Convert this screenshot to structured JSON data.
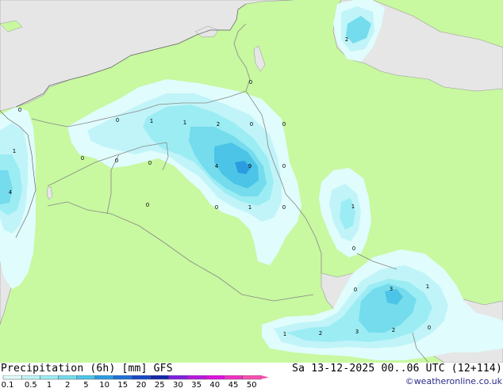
{
  "title": "Precipitation (6h) [mm] GFS",
  "datetime": "Sa 13-12-2025 00..06 UTC (12+114)",
  "credit": "©weatheronline.co.uk",
  "legend": {
    "labels": [
      "0.1",
      "0.5",
      "1",
      "2",
      "5",
      "10",
      "15",
      "20",
      "25",
      "30",
      "35",
      "40",
      "45",
      "50"
    ],
    "colors": [
      "#e0fcfc",
      "#c0f4f8",
      "#9cecf4",
      "#74dcec",
      "#4cc4e8",
      "#2c9ce0",
      "#2070d8",
      "#1848c8",
      "#1028a8",
      "#8020e0",
      "#b818e0",
      "#e010e0",
      "#f030c8",
      "#f850b0"
    ]
  },
  "map_labels": [
    {
      "text": "2",
      "region": "caspian"
    },
    {
      "text": "0",
      "region": "lebanon-coast"
    },
    {
      "text": "1",
      "region": "levant-north"
    },
    {
      "text": "4",
      "region": "levant-south"
    },
    {
      "text": "0",
      "region": "syria-west"
    },
    {
      "text": "0",
      "region": "syria-desert"
    },
    {
      "text": "0",
      "region": "syria-central"
    },
    {
      "text": "0",
      "region": "syria-east"
    },
    {
      "text": "1",
      "region": "north-iraq"
    },
    {
      "text": "1",
      "region": "north-iraq-east"
    },
    {
      "text": "2",
      "region": "kurdistan"
    },
    {
      "text": "0",
      "region": "zagros-north"
    },
    {
      "text": "0",
      "region": "iran-border"
    },
    {
      "text": "0",
      "region": "turkey-east"
    },
    {
      "text": "4",
      "region": "iraq-central-west"
    },
    {
      "text": "9",
      "region": "baghdad"
    },
    {
      "text": "0",
      "region": "iran-west"
    },
    {
      "text": "0",
      "region": "iraq-west"
    },
    {
      "text": "0",
      "region": "euphrates"
    },
    {
      "text": "1",
      "region": "iraq-south"
    },
    {
      "text": "0",
      "region": "basra"
    },
    {
      "text": "1",
      "region": "iran-southwest"
    },
    {
      "text": "0",
      "region": "gulf-north"
    },
    {
      "text": "0",
      "region": "gulf-coast-north"
    },
    {
      "text": "3",
      "region": "gulf-center"
    },
    {
      "text": "1",
      "region": "gulf-east"
    },
    {
      "text": "1",
      "region": "arabia-coast"
    },
    {
      "text": "2",
      "region": "arabia-coast-east"
    },
    {
      "text": "3",
      "region": "qatar"
    },
    {
      "text": "2",
      "region": "gulf-south"
    },
    {
      "text": "0",
      "region": "uae"
    }
  ]
}
